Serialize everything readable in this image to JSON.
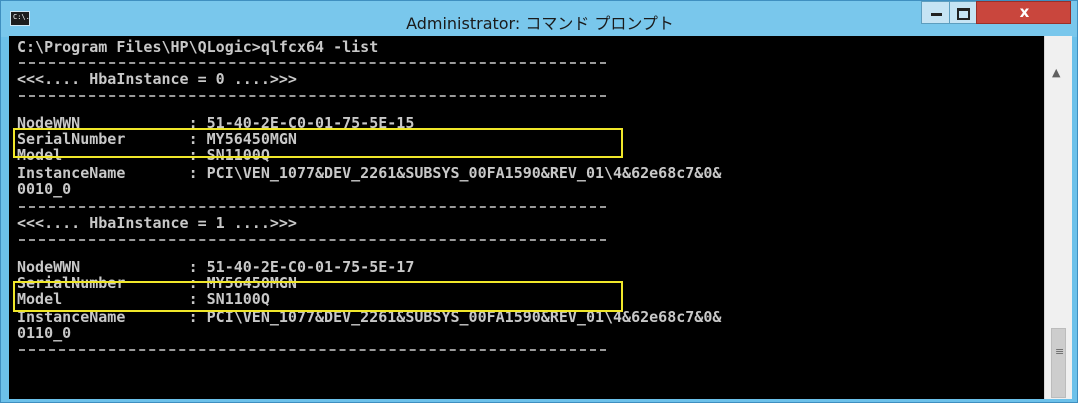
{
  "window": {
    "title": "Administrator: コマンド プロンプト",
    "icon_label": "C:\\.",
    "controls": {
      "minimize": "minimize-icon",
      "maximize": "maximize-icon",
      "close_label": "x"
    }
  },
  "console": {
    "command": "C:\\Program Files\\HP\\QLogic>qlfcx64 -list",
    "instances": [
      {
        "header": "<<<.... HbaInstance = 0 ....>>>",
        "node_wwn": "NodeWWN            : 51-40-2E-C0-01-75-5E-15",
        "serial": "SerialNumber       : MY56450MGN",
        "model": "Model              : SN1100Q",
        "instance_name": "InstanceName       : PCI\\VEN_1077&DEV_2261&SUBSYS_00FA1590&REV_01\\4&62e68c7&0&",
        "instance_name_cont": "0010_0"
      },
      {
        "header": "<<<.... HbaInstance = 1 ....>>>",
        "node_wwn": "NodeWWN            : 51-40-2E-C0-01-75-5E-17",
        "serial": "SerialNumber       : MY56450MGN",
        "model": "Model              : SN1100Q",
        "instance_name": "InstanceName       : PCI\\VEN_1077&DEV_2261&SUBSYS_00FA1590&REV_01\\4&62e68c7&0&",
        "instance_name_cont": "0110_0"
      }
    ]
  },
  "colors": {
    "text": "#c8c8c8",
    "highlight": "#f0e72a",
    "titlebar": "#79c7ec",
    "close": "#c9463d"
  }
}
